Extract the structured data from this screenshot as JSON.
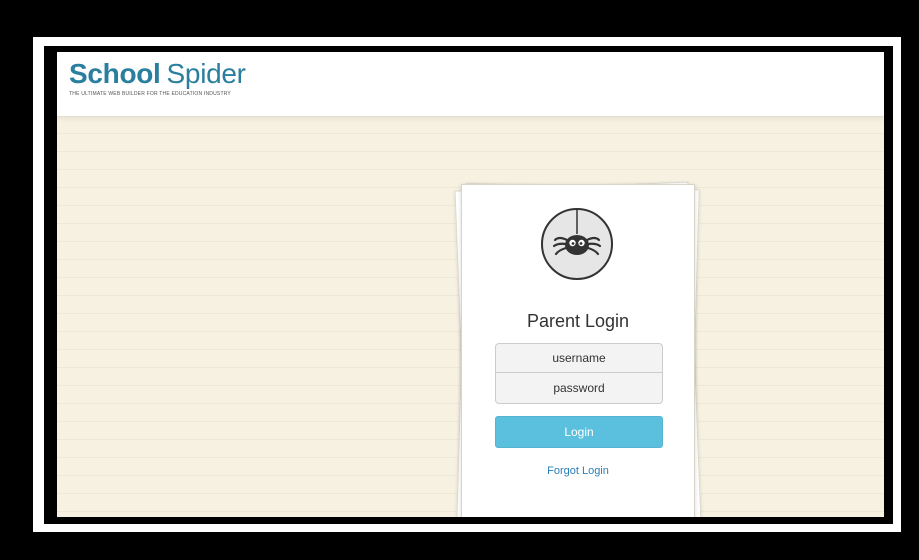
{
  "header": {
    "logo_school": "School",
    "logo_spider": "Spider",
    "logo_tagline": "THE ULTIMATE WEB BUILDER FOR THE EDUCATION INDUSTRY"
  },
  "login": {
    "title": "Parent Login",
    "username_placeholder": "username",
    "password_placeholder": "password",
    "login_label": "Login",
    "forgot_label": "Forgot Login"
  },
  "colors": {
    "brand": "#2a7f9e",
    "button": "#5bc0de",
    "link": "#2a7fb8",
    "background": "#f6f1e1"
  },
  "icons": {
    "avatar": "spider-icon"
  }
}
